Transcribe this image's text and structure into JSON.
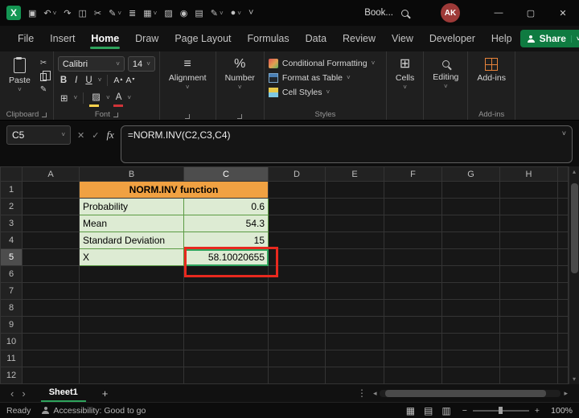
{
  "colors": {
    "accent_green": "#2EA35C",
    "share_green": "#0F7B41",
    "header_orange": "#F0A142",
    "cell_green": "#DDEBD3",
    "cell_border_green": "#5B9B44",
    "annotation_red": "#E8291F"
  },
  "glyphs": {
    "caret": "˅",
    "check": "✓",
    "close": "✕",
    "minimize": "—",
    "maximize": "▢",
    "dots_v": "⋮",
    "chev_l": "‹",
    "chev_r": "›",
    "tri_l": "◂",
    "tri_r": "▸",
    "up": "▴",
    "down": "▾",
    "plus": "+",
    "minus": "−",
    "view_grid": "▦",
    "view_page": "▤",
    "view_break": "▥",
    "menu_lines": "≡",
    "percent": "%",
    "borders": "⊞",
    "cells_icon": "⊞",
    "scissors": "✂",
    "pen": "✎",
    "fill": "▨",
    "fontA": "A",
    "fx": "fx"
  },
  "titlebar": {
    "document_title": "Book...",
    "avatar_initials": "AK",
    "icons": [
      {
        "name": "excel-logo",
        "glyph": "X"
      },
      {
        "name": "save-icon",
        "glyph": "▣"
      },
      {
        "name": "undo-icon",
        "glyph": "↶",
        "caret": true
      },
      {
        "name": "redo-icon",
        "glyph": "↷"
      },
      {
        "name": "copy-icon",
        "glyph": "◫"
      },
      {
        "name": "cut-icon",
        "glyph": "✂"
      },
      {
        "name": "draw-icon",
        "glyph": "✎",
        "caret": true
      },
      {
        "name": "database-icon",
        "glyph": "≣"
      },
      {
        "name": "table-icon",
        "glyph": "▦",
        "caret": true
      },
      {
        "name": "format-painter-icon",
        "glyph": "▨"
      },
      {
        "name": "camera-icon",
        "glyph": "◉"
      },
      {
        "name": "workbook-icon",
        "glyph": "▤"
      },
      {
        "name": "pen-icon",
        "glyph": "✎",
        "caret": true
      },
      {
        "name": "record-icon",
        "glyph": "●",
        "caret": true
      },
      {
        "name": "qat-overflow-caret",
        "glyph": "˅"
      }
    ]
  },
  "menubar": {
    "items": [
      {
        "label": "File"
      },
      {
        "label": "Insert"
      },
      {
        "label": "Home",
        "active": true
      },
      {
        "label": "Draw"
      },
      {
        "label": "Page Layout"
      },
      {
        "label": "Formulas"
      },
      {
        "label": "Data"
      },
      {
        "label": "Review"
      },
      {
        "label": "View"
      },
      {
        "label": "Developer"
      },
      {
        "label": "Help"
      }
    ],
    "share_label": "Share"
  },
  "ribbon": {
    "clipboard": {
      "paste": "Paste",
      "group": "Clipboard"
    },
    "font": {
      "name": "Calibri",
      "size": "14",
      "bold": "B",
      "italic": "I",
      "underline": "U",
      "group": "Font"
    },
    "alignment": {
      "label": "Alignment"
    },
    "number": {
      "label": "Number"
    },
    "styles": {
      "items": [
        "Conditional Formatting",
        "Format as Table",
        "Cell Styles"
      ],
      "group": "Styles"
    },
    "cells": {
      "label": "Cells"
    },
    "editing": {
      "label": "Editing"
    },
    "addins": {
      "label": "Add-ins",
      "group": "Add-ins"
    }
  },
  "formula_bar": {
    "name_box": "C5",
    "formula": "=NORM.INV(C2,C3,C4)"
  },
  "grid": {
    "columns": [
      "A",
      "B",
      "C",
      "D",
      "E",
      "F",
      "G",
      "H"
    ],
    "row_count": 12,
    "selected_cell": "C5",
    "selected_col": "C",
    "selected_row": 5,
    "cells": {
      "B1": {
        "text": "NORM.INV function",
        "class": "c-orange",
        "colspan": 2
      },
      "B2": {
        "text": "Probability",
        "class": "c-green"
      },
      "C2": {
        "text": "0.6",
        "class": "c-green num"
      },
      "B3": {
        "text": "Mean",
        "class": "c-green"
      },
      "C3": {
        "text": "54.3",
        "class": "c-green num"
      },
      "B4": {
        "text": "Standard Deviation",
        "class": "c-green"
      },
      "C4": {
        "text": "15",
        "class": "c-green num"
      },
      "B5": {
        "text": "X",
        "class": "c-green"
      },
      "C5": {
        "text": "58.10020655",
        "class": "c-green num selected"
      }
    }
  },
  "sheet_bar": {
    "tabs": [
      {
        "label": "Sheet1",
        "active": true
      }
    ],
    "add_label": "+"
  },
  "status_bar": {
    "ready": "Ready",
    "accessibility": "Accessibility: Good to go",
    "zoom": "100%"
  }
}
